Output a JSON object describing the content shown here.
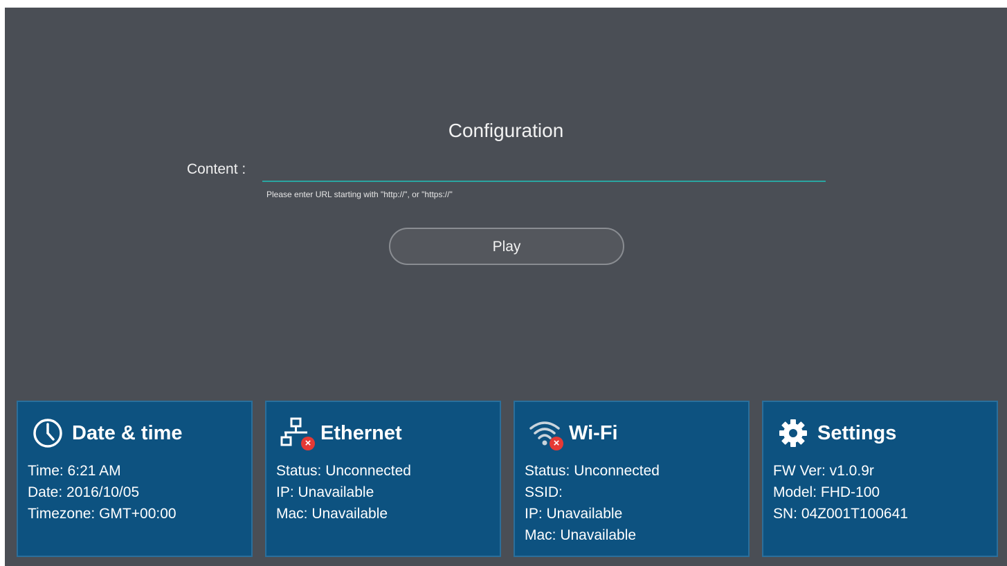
{
  "config": {
    "title": "Configuration",
    "content_label": "Content :",
    "url_value": "",
    "hint": "Please enter URL starting with \"http://\", or \"https://\"",
    "play_label": "Play"
  },
  "cards": {
    "datetime": {
      "title": "Date & time",
      "icon": "clock-icon",
      "lines": [
        "Time: 6:21 AM",
        "Date: 2016/10/05",
        "Timezone: GMT+00:00"
      ]
    },
    "ethernet": {
      "title": "Ethernet",
      "icon": "ethernet-disconnected-icon",
      "lines": [
        "Status: Unconnected",
        "IP: Unavailable",
        "Mac: Unavailable"
      ]
    },
    "wifi": {
      "title": "Wi-Fi",
      "icon": "wifi-disconnected-icon",
      "lines": [
        "Status: Unconnected",
        "SSID:",
        "IP: Unavailable",
        "Mac: Unavailable"
      ]
    },
    "settings": {
      "title": "Settings",
      "icon": "gear-icon",
      "lines": [
        "FW Ver: v1.0.9r",
        "Model: FHD-100",
        "SN: 04Z001T100641"
      ]
    }
  },
  "colors": {
    "background": "#4a4e55",
    "accent": "#2aa6a1",
    "card": "#0d5280",
    "error": "#e53935"
  }
}
